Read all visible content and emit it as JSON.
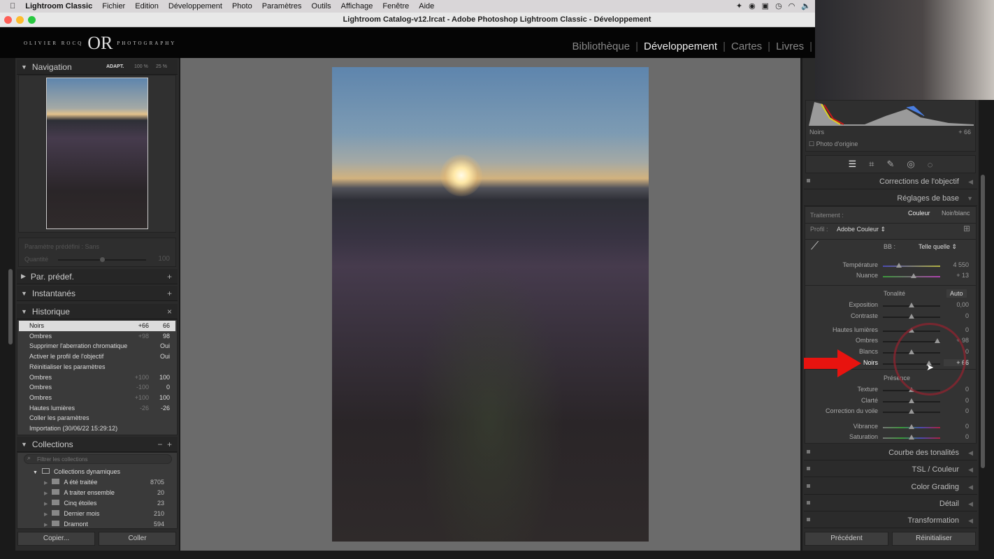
{
  "menubar": {
    "app": "Lightroom Classic",
    "items": [
      "Fichier",
      "Edition",
      "Développement",
      "Photo",
      "Paramètres",
      "Outils",
      "Affichage",
      "Fenêtre",
      "Aide"
    ]
  },
  "window": {
    "title": "Lightroom Catalog-v12.lrcat - Adobe Photoshop Lightroom Classic - Développement"
  },
  "logo": {
    "left": "OLIVIER ROCQ",
    "mark": "OR",
    "right": "PHOTOGRAPHY"
  },
  "modules": [
    {
      "label": "Bibliothèque",
      "active": false
    },
    {
      "label": "Développement",
      "active": true
    },
    {
      "label": "Cartes",
      "active": false
    },
    {
      "label": "Livres",
      "active": false
    }
  ],
  "left": {
    "navigation": {
      "title": "Navigation",
      "fit": "ADAPT.",
      "zoom1": "100 %",
      "zoom2": "25 %"
    },
    "preset": {
      "label": "Paramètre prédéfini : Sans",
      "amount_label": "Quantité",
      "amount": "100",
      "amount_level": 0.5
    },
    "presets_title": "Par. prédef.",
    "snapshots_title": "Instantanés",
    "history_title": "Historique",
    "history": [
      {
        "label": "Noirs",
        "a": "+66",
        "b": "66",
        "selected": true
      },
      {
        "label": "Ombres",
        "a": "+98",
        "b": "98"
      },
      {
        "label": "Supprimer l'aberration chromatique",
        "a": "",
        "b": "Oui"
      },
      {
        "label": "Activer le profil de l'objectif",
        "a": "",
        "b": "Oui"
      },
      {
        "label": "Réinitialiser les paramètres",
        "a": "",
        "b": ""
      },
      {
        "label": "Ombres",
        "a": "+100",
        "b": "100"
      },
      {
        "label": "Ombres",
        "a": "-100",
        "b": "0"
      },
      {
        "label": "Ombres",
        "a": "+100",
        "b": "100"
      },
      {
        "label": "Hautes lumières",
        "a": "-26",
        "b": "-26"
      },
      {
        "label": "Coller les paramètres",
        "a": "",
        "b": ""
      },
      {
        "label": "Importation (30/06/22 15:29:12)",
        "a": "",
        "b": ""
      }
    ],
    "collections_title": "Collections",
    "filter_placeholder": "Filtrer les collections",
    "smart_group": "Collections dynamiques",
    "collections": [
      {
        "label": "A été traitée",
        "count": "8705"
      },
      {
        "label": "A traiter ensemble",
        "count": "20"
      },
      {
        "label": "Cinq étoiles",
        "count": "23"
      },
      {
        "label": "Dernier mois",
        "count": "210"
      },
      {
        "label": "Dramont",
        "count": "594"
      }
    ],
    "copy": "Copier...",
    "paste": "Coller"
  },
  "right": {
    "histogram": {
      "label": "Noirs",
      "value": "+ 66",
      "original": "Photo d'origine"
    },
    "tools": [
      "sliders-icon",
      "crop-icon",
      "heal-icon",
      "redeye-icon",
      "mask-icon"
    ],
    "sections_top": [
      "Corrections de l'objectif",
      "Réglages de base"
    ],
    "treatment": {
      "label": "Traitement :",
      "color": "Couleur",
      "bw": "Noir/blanc"
    },
    "profile": {
      "label": "Profil :",
      "value": "Adobe Couleur"
    },
    "wb": {
      "label": "BB :",
      "value": "Telle quelle"
    },
    "wb_sliders": [
      {
        "label": "Température",
        "value": "4 550",
        "level": 0.28
      },
      {
        "label": "Nuance",
        "value": "+ 13",
        "level": 0.54
      }
    ],
    "tone_title": "Tonalité",
    "auto": "Auto",
    "tone_sliders": [
      {
        "label": "Exposition",
        "value": "0,00",
        "level": 0.5
      },
      {
        "label": "Contraste",
        "value": "0",
        "level": 0.5
      },
      {
        "label": "Hautes lumières",
        "value": "0",
        "level": 0.5
      },
      {
        "label": "Ombres",
        "value": "+ 98",
        "level": 0.95
      },
      {
        "label": "Blancs",
        "value": "0",
        "level": 0.5
      },
      {
        "label": "Noirs",
        "value": "+ 66",
        "level": 0.8
      }
    ],
    "presence_title": "Présence",
    "presence_sliders": [
      {
        "label": "Texture",
        "value": "0",
        "level": 0.5
      },
      {
        "label": "Clarté",
        "value": "0",
        "level": 0.5
      },
      {
        "label": "Correction du voile",
        "value": "0",
        "level": 0.5
      },
      {
        "label": "Vibrance",
        "value": "0",
        "level": 0.5
      },
      {
        "label": "Saturation",
        "value": "0",
        "level": 0.5
      }
    ],
    "sections_bottom": [
      "Courbe des tonalités",
      "TSL / Couleur",
      "Color Grading",
      "Détail",
      "Transformation"
    ],
    "previous": "Précédent",
    "reset": "Réinitialiser"
  },
  "colors": {
    "annotation_arrow": "#e8130f",
    "annotation_circle": "#8a2430"
  }
}
